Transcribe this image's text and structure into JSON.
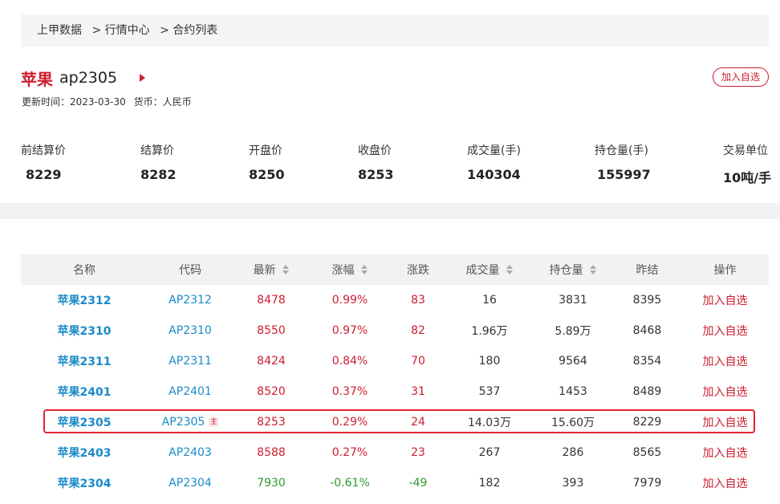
{
  "breadcrumb": {
    "home": "上甲数据",
    "sep1": ">",
    "level2": "行情中心",
    "sep2": ">",
    "level3": "合约列表"
  },
  "header": {
    "name": "苹果",
    "code": "ap2305",
    "update_label": "更新时间：2023-03-30",
    "currency_label": "货币：人民币",
    "add_button": "加入自选"
  },
  "stats": [
    {
      "label": "前结算价",
      "value": "8229"
    },
    {
      "label": "结算价",
      "value": "8282"
    },
    {
      "label": "开盘价",
      "value": "8250"
    },
    {
      "label": "收盘价",
      "value": "8253"
    },
    {
      "label": "成交量(手)",
      "value": "140304"
    },
    {
      "label": "持仓量(手)",
      "value": "155997"
    },
    {
      "label": "交易单位",
      "value": "10吨/手"
    }
  ],
  "table": {
    "headers": [
      "名称",
      "代码",
      "最新",
      "涨幅",
      "涨跌",
      "成交量",
      "持仓量",
      "昨结",
      "操作"
    ],
    "rows": [
      {
        "name": "苹果2312",
        "code": "AP2312",
        "last": "8478",
        "pct": "0.99%",
        "chg": "83",
        "vol": "16",
        "oi": "3831",
        "prev": "8395",
        "op": "加入自选",
        "dir": "up"
      },
      {
        "name": "苹果2310",
        "code": "AP2310",
        "last": "8550",
        "pct": "0.97%",
        "chg": "82",
        "vol": "1.96万",
        "oi": "5.89万",
        "prev": "8468",
        "op": "加入自选",
        "dir": "up"
      },
      {
        "name": "苹果2311",
        "code": "AP2311",
        "last": "8424",
        "pct": "0.84%",
        "chg": "70",
        "vol": "180",
        "oi": "9564",
        "prev": "8354",
        "op": "加入自选",
        "dir": "up"
      },
      {
        "name": "苹果2401",
        "code": "AP2401",
        "last": "8520",
        "pct": "0.37%",
        "chg": "31",
        "vol": "537",
        "oi": "1453",
        "prev": "8489",
        "op": "加入自选",
        "dir": "up"
      },
      {
        "name": "苹果2305",
        "code": "AP2305",
        "badge": "主",
        "last": "8253",
        "pct": "0.29%",
        "chg": "24",
        "vol": "14.03万",
        "oi": "15.60万",
        "prev": "8229",
        "op": "加入自选",
        "dir": "up"
      },
      {
        "name": "苹果2403",
        "code": "AP2403",
        "last": "8588",
        "pct": "0.27%",
        "chg": "23",
        "vol": "267",
        "oi": "286",
        "prev": "8565",
        "op": "加入自选",
        "dir": "up"
      },
      {
        "name": "苹果2304",
        "code": "AP2304",
        "last": "7930",
        "pct": "-0.61%",
        "chg": "-49",
        "vol": "182",
        "oi": "393",
        "prev": "7979",
        "op": "加入自选",
        "dir": "down"
      }
    ]
  },
  "colors": {
    "up": "#cc1e2f",
    "down": "#2e9a2e",
    "link": "#1a8bc9",
    "highlight": "#e2242f"
  }
}
